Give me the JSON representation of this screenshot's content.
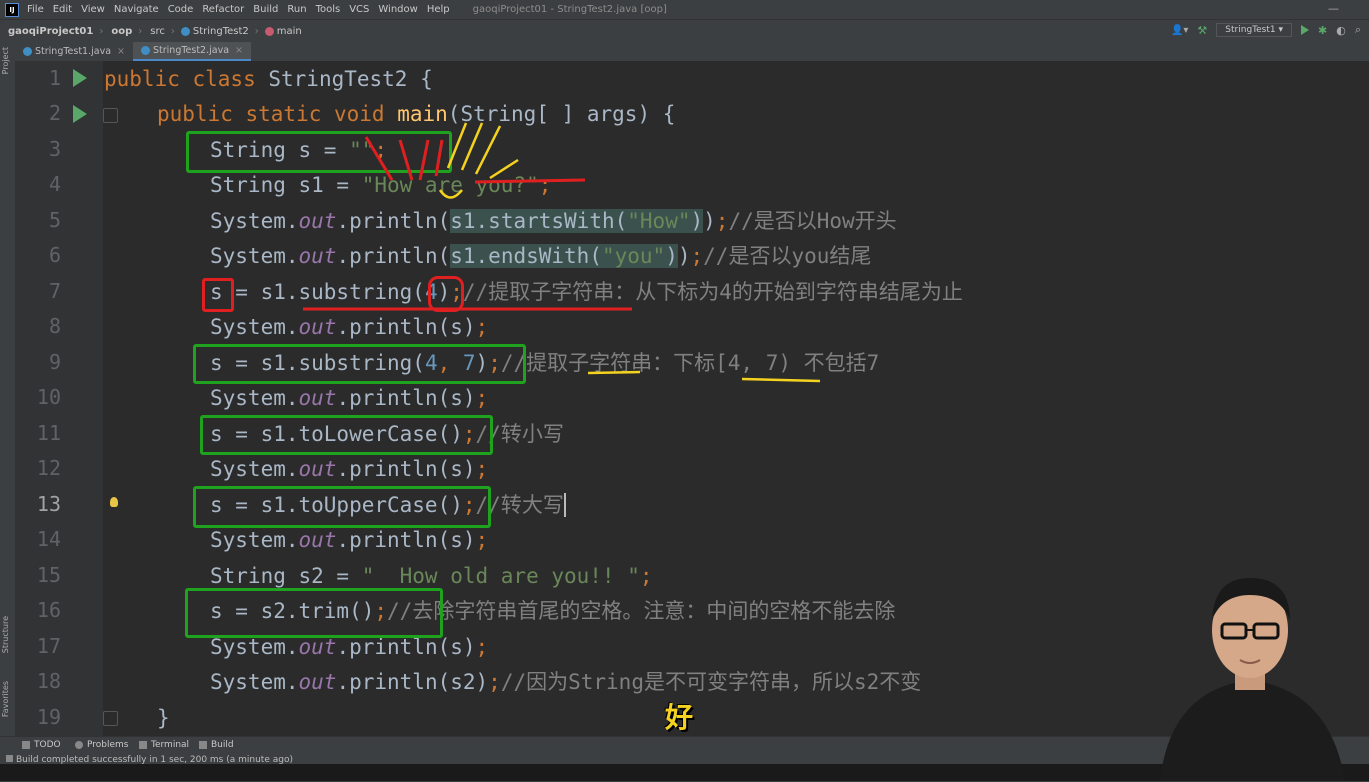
{
  "menubar": {
    "logo": "IJ",
    "items": [
      "File",
      "Edit",
      "View",
      "Navigate",
      "Code",
      "Refactor",
      "Build",
      "Run",
      "Tools",
      "VCS",
      "Window",
      "Help"
    ],
    "window_title": "gaoqiProject01 - StringTest2.java [oop]"
  },
  "navbar": {
    "project": "gaoqiProject01",
    "module": "oop",
    "src": "src",
    "class": "StringTest2",
    "method": "main",
    "run_config": "StringTest1"
  },
  "tabs": [
    {
      "label": "StringTest1.java",
      "active": false
    },
    {
      "label": "StringTest2.java",
      "active": true
    }
  ],
  "side_labels": {
    "project": "Project",
    "structure": "Structure",
    "favorites": "Favorites"
  },
  "line_numbers": [
    "1",
    "2",
    "3",
    "4",
    "5",
    "6",
    "7",
    "8",
    "9",
    "10",
    "11",
    "12",
    "13",
    "14",
    "15",
    "16",
    "17",
    "18",
    "19"
  ],
  "current_line": "13",
  "code": {
    "l1": {
      "kw": "public class ",
      "name": "StringTest2 {"
    },
    "l2": {
      "kw": "public static void ",
      "fn": "main",
      "rest": "(String[ ] args) {"
    },
    "l3": {
      "t1": "String s = ",
      "str": "\"\"",
      "semi": ";"
    },
    "l4": {
      "t1": "String s1 = ",
      "str": "\"How are you?\"",
      "semi": ";"
    },
    "l5": {
      "t1": "System.",
      "fld": "out",
      "t2": ".println(",
      "hl1": "s1.startsWith(",
      "str": "\"How\"",
      "hl2": ")",
      "t3": ")",
      "semi": ";",
      "cmt": "//是否以How开头"
    },
    "l6": {
      "t1": "System.",
      "fld": "out",
      "t2": ".println(",
      "hl1": "s1.endsWith(",
      "str": "\"you\"",
      "hl2": ")",
      "t3": ")",
      "semi": ";",
      "cmt": "//是否以you结尾"
    },
    "l7": {
      "t1": "s = s1.substring(",
      "num": "4",
      "t2": ")",
      "semi": ";",
      "cmt": "//提取子字符串：从下标为4的开始到字符串结尾为止"
    },
    "l8": {
      "t1": "System.",
      "fld": "out",
      "t2": ".println(s)",
      "semi": ";"
    },
    "l9": {
      "t1": "s = s1.substring(",
      "num1": "4",
      "comma": ", ",
      "num2": "7",
      "t2": ")",
      "semi": ";",
      "cmt": "//提取子字符串：下标[4, 7) 不包括7"
    },
    "l10": {
      "t1": "System.",
      "fld": "out",
      "t2": ".println(s)",
      "semi": ";"
    },
    "l11": {
      "t1": "s = s1.toLowerCase()",
      "semi": ";",
      "cmt": "//转小写"
    },
    "l12": {
      "t1": "System.",
      "fld": "out",
      "t2": ".println(s)",
      "semi": ";"
    },
    "l13": {
      "t1": "s = s1.toUpperCase()",
      "semi": ";",
      "cmt": "//转大写"
    },
    "l14": {
      "t1": "System.",
      "fld": "out",
      "t2": ".println(s)",
      "semi": ";"
    },
    "l15": {
      "t1": "String s2 = ",
      "str": "\"  How old are you!! \"",
      "semi": ";"
    },
    "l16": {
      "t1": "s = s2.trim()",
      "semi": ";",
      "cmt": "//去除字符串首尾的空格。注意：中间的空格不能去除"
    },
    "l17": {
      "t1": "System.",
      "fld": "out",
      "t2": ".println(s)",
      "semi": ";"
    },
    "l18": {
      "t1": "System.",
      "fld": "out",
      "t2": ".println(s2)",
      "semi": ";",
      "cmt": "//因为String是不可变字符串，所以s2不变"
    },
    "l19": {
      "t1": "}"
    }
  },
  "toolwindows": [
    "TODO",
    "Problems",
    "Terminal",
    "Build"
  ],
  "status_message": "Build completed successfully in 1 sec, 200 ms (a minute ago)",
  "subtitle": "好",
  "colors": {
    "keyword": "#cc7832",
    "string": "#6a8759",
    "comment": "#808080",
    "number": "#6897bb",
    "field": "#9876aa",
    "method_decl": "#ffc66d",
    "annotation_green": "#1fa31f",
    "annotation_red": "#e02020",
    "annotation_yellow": "#f5d21f"
  }
}
